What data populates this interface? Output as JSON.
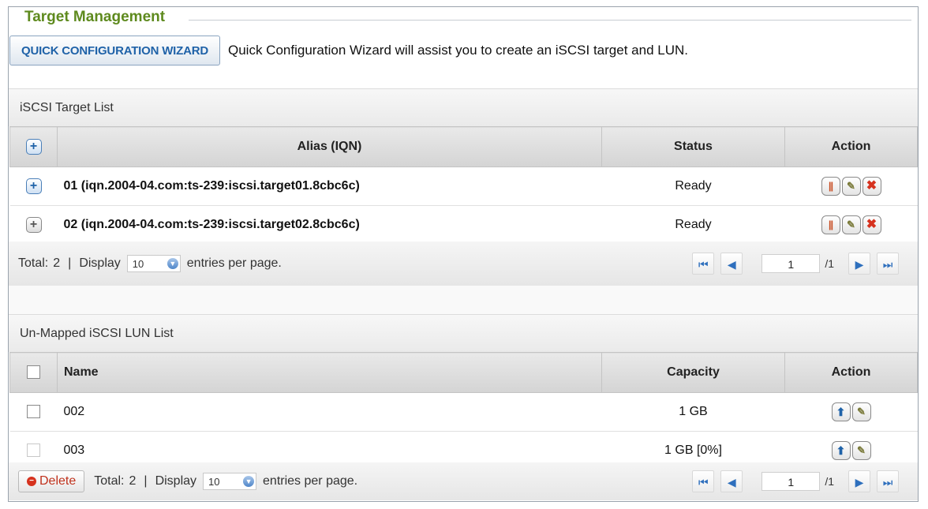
{
  "panel": {
    "title": "Target Management"
  },
  "wizard": {
    "button_label": "QUICK CONFIGURATION WIZARD",
    "description": "Quick Configuration Wizard will assist you to create an iSCSI target and LUN."
  },
  "target_list": {
    "title": "iSCSI Target List",
    "columns": {
      "alias": "Alias (IQN)",
      "status": "Status",
      "action": "Action"
    },
    "rows": [
      {
        "alias": "01 (iqn.2004-04.com:ts-239:iscsi.target01.8cbc6c)",
        "status": "Ready"
      },
      {
        "alias": "02 (iqn.2004-04.com:ts-239:iscsi.target02.8cbc6c)",
        "status": "Ready"
      }
    ],
    "footer": {
      "total_label": "Total:",
      "total": "2",
      "display_label": "Display",
      "per_page": "10",
      "entries_label": "entries per page.",
      "page": "1",
      "page_total": "/1"
    }
  },
  "lun_list": {
    "title": "Un-Mapped iSCSI LUN List",
    "columns": {
      "name": "Name",
      "capacity": "Capacity",
      "action": "Action"
    },
    "rows": [
      {
        "name": "002",
        "capacity": "1 GB"
      },
      {
        "name": "003",
        "capacity": "1 GB [0%]"
      }
    ],
    "footer": {
      "delete_label": "Delete",
      "total_label": "Total:",
      "total": "2",
      "display_label": "Display",
      "per_page": "10",
      "entries_label": "entries per page.",
      "page": "1",
      "page_total": "/1"
    }
  },
  "icons": {
    "add": "+",
    "pause": "||",
    "edit": "✎",
    "delete": "✖",
    "first": "⏮",
    "prev": "◀",
    "next": "▶",
    "last": "⏭",
    "map_up": "⬆",
    "dropdown": "▼"
  },
  "colors": {
    "title_green": "#5e8a1e",
    "wizard_blue": "#1f62a8",
    "delete_red": "#d6321e"
  }
}
